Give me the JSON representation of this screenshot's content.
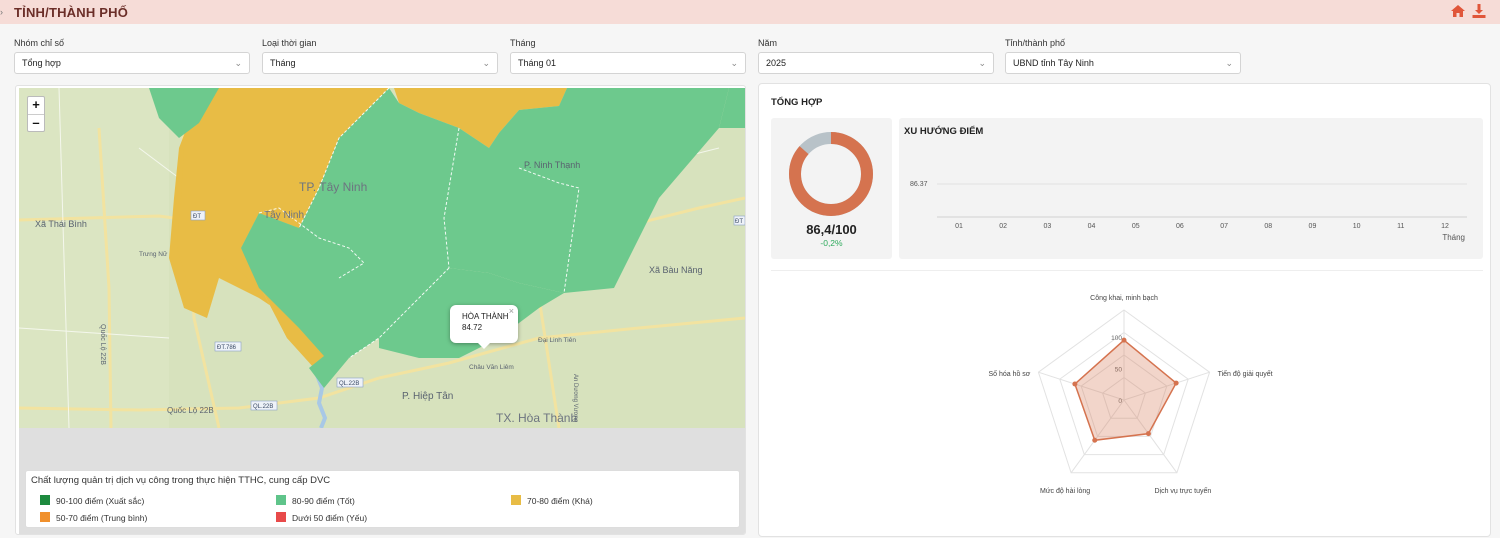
{
  "header": {
    "title": "TỈNH/THÀNH PHỐ",
    "toggle_glyph": "›",
    "icons": [
      "home-icon",
      "download-icon"
    ],
    "bg_color": "#f6dcd7",
    "title_color": "#6b2e28",
    "icon_color": "#e0563a"
  },
  "filters": [
    {
      "label": "Nhóm chỉ số",
      "value": "Tổng hợp"
    },
    {
      "label": "Loại thời gian",
      "value": "Tháng"
    },
    {
      "label": "Tháng",
      "value": "Tháng 01"
    },
    {
      "label": "Năm",
      "value": "2025"
    },
    {
      "label": "Tỉnh/thành phố",
      "value": "UBND tỉnh Tây Ninh"
    }
  ],
  "map": {
    "zoom_in": "+",
    "zoom_out": "–",
    "labels": {
      "p_ninh_thanh": "P. Ninh Thạnh",
      "tp_tay_ninh": "TP. Tây Ninh",
      "xa_thai_binh": "Xã Thái Bình",
      "xa_bau_nang": "Xã Bàu Năng",
      "p_hiep_tan": "P. Hiệp Tân",
      "tx_hoa_thanh": "TX. Hòa Thành",
      "tay_ninh_small": "Tây Ninh",
      "quoc_lo_22b_v": "Quốc Lộ 22B",
      "quoc_lo_22b_h": "Quốc Lộ 22B",
      "dai_linh_tien": "Đại Linh Tiên",
      "chau_van_liem": "Châu Văn Liêm",
      "trung_nu": "Trưng Nữ",
      "ap_duong": "An Dương Vương",
      "shield_dt786": "ĐT.786",
      "shield_ql22b_1": "QL.22B",
      "shield_ql22b_2": "QL.22B",
      "shield_dt_1": "ĐT",
      "shield_dt_2": "ĐT"
    },
    "popup": {
      "name": "HÒA THÀNH",
      "value": "84.72",
      "close": "×"
    },
    "water_color": "#a8c8e6",
    "land_color": "#d7e2bd"
  },
  "legend": {
    "title": "Chất lượng quản trị dịch vụ công trong thực hiện TTHC, cung cấp DVC",
    "items": [
      {
        "label": "90-100 điểm (Xuất sắc)",
        "color": "#1d8a3e"
      },
      {
        "label": "80-90 điểm (Tốt)",
        "color": "#5fc48a"
      },
      {
        "label": "70-80 điểm (Khá)",
        "color": "#e8bc45"
      },
      {
        "label": "50-70 điểm (Trung bình)",
        "color": "#f0902c"
      },
      {
        "label": "Dưới 50 điểm (Yếu)",
        "color": "#e84a4a"
      }
    ]
  },
  "summary": {
    "title": "TỔNG HỢP",
    "score_text": "86,4/100",
    "change_text": "-0,2%",
    "donut": {
      "value": 86.4,
      "max": 100,
      "fill_color": "#d5734f",
      "rest_color": "#b8c2c8"
    },
    "trend": {
      "title": "XU HƯỚNG ĐIỂM",
      "y_label": "86.37",
      "x_ticks": [
        "01",
        "02",
        "03",
        "04",
        "05",
        "06",
        "07",
        "08",
        "09",
        "10",
        "11",
        "12"
      ],
      "x_name": "Tháng"
    }
  },
  "chart_data": [
    {
      "type": "line",
      "title": "XU HƯỚNG ĐIỂM",
      "x": [
        "01",
        "02",
        "03",
        "04",
        "05",
        "06",
        "07",
        "08",
        "09",
        "10",
        "11",
        "12"
      ],
      "xlabel": "Tháng",
      "y_tick": 86.37,
      "series": []
    },
    {
      "type": "radar",
      "axes": [
        "Công khai, minh bạch",
        "Tiến độ giải quyết",
        "Dịch vụ trực tuyến",
        "Mức độ hài lòng",
        "Số hóa hồ sơ"
      ],
      "values": [
        95,
        87,
        66,
        79,
        82
      ],
      "range": [
        0,
        100
      ],
      "ticks": [
        "100",
        "50",
        "0"
      ],
      "fill_color": "#d5734f"
    }
  ]
}
